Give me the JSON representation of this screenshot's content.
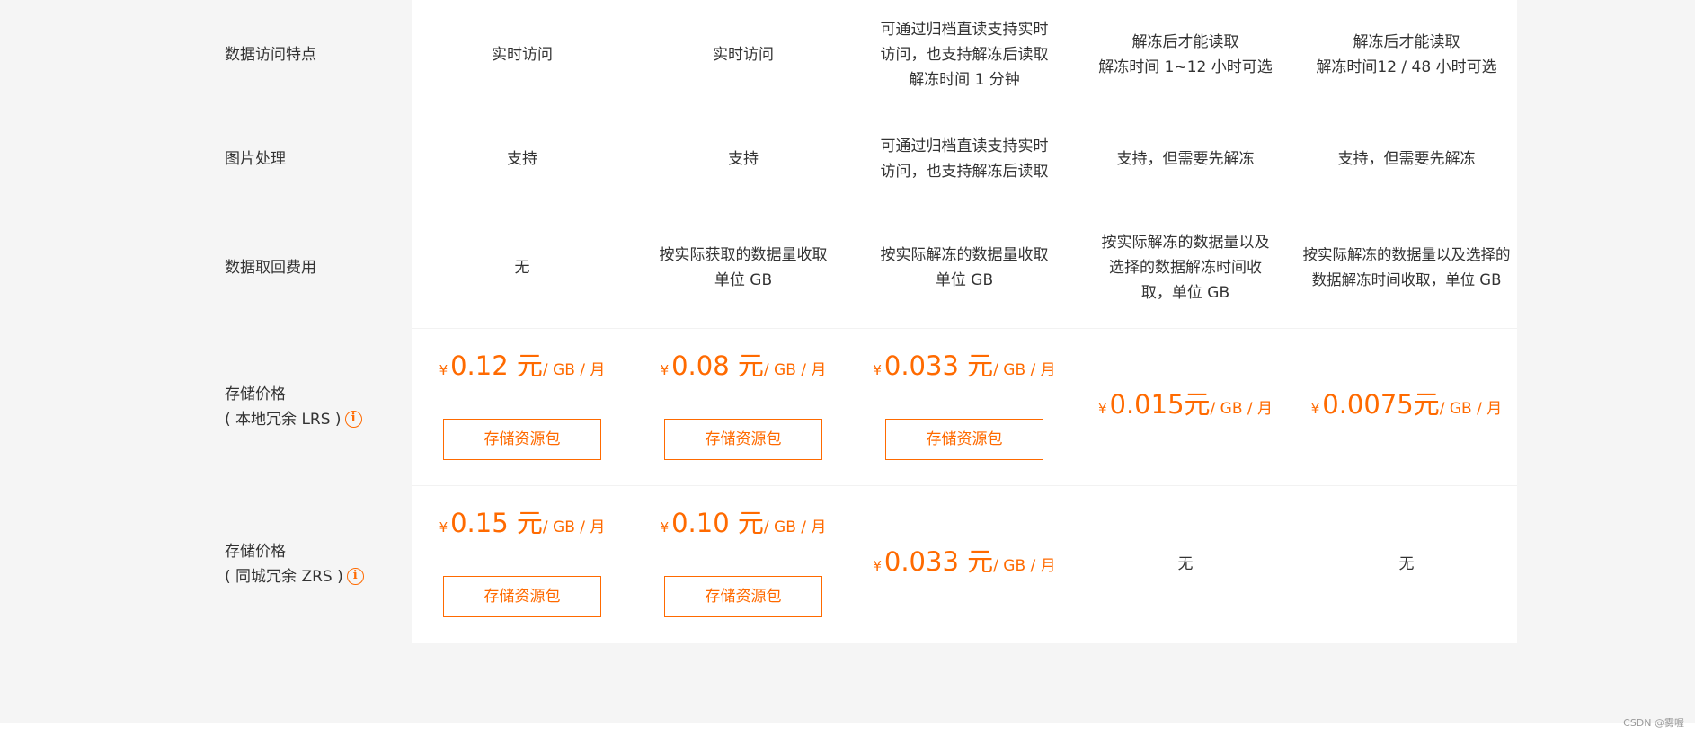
{
  "table": {
    "rows": [
      {
        "label": "数据访问特点",
        "cells": [
          "实时访问",
          "实时访问",
          "可通过归档直读支持实时\n访问，也支持解冻后读取\n解冻时间 1 分钟",
          "解冻后才能读取\n解冻时间 1~12 小时可选",
          "解冻后才能读取\n解冻时间12 / 48 小时可选"
        ]
      },
      {
        "label": "图片处理",
        "cells": [
          "支持",
          "支持",
          "可通过归档直读支持实时\n访问，也支持解冻后读取",
          "支持，但需要先解冻",
          "支持，但需要先解冻"
        ]
      },
      {
        "label": "数据取回费用",
        "cells": [
          "无",
          "按实际获取的数据量收取\n单位 GB",
          "按实际解冻的数据量收取\n单位 GB",
          "按实际解冻的数据量以及\n选择的数据解冻时间收\n取，单位 GB",
          "按实际解冻的数据量以及选择的\n数据解冻时间收取，单位 GB"
        ]
      },
      {
        "label_line1": "存储价格",
        "label_line2": "( 本地冗余 LRS )",
        "prices": [
          {
            "yen": "¥",
            "amount": "0.12 元",
            "unit": "/ GB / 月",
            "button": "存储资源包"
          },
          {
            "yen": "¥",
            "amount": "0.08 元",
            "unit": "/ GB / 月",
            "button": "存储资源包"
          },
          {
            "yen": "¥",
            "amount": "0.033 元",
            "unit": "/ GB / 月",
            "button": "存储资源包"
          },
          {
            "yen": "¥",
            "amount": "0.015元",
            "unit": "/ GB / 月"
          },
          {
            "yen": "¥",
            "amount": "0.0075元",
            "unit": "/ GB / 月"
          }
        ]
      },
      {
        "label_line1": "存储价格",
        "label_line2": "( 同城冗余 ZRS )",
        "prices": [
          {
            "yen": "¥",
            "amount": "0.15 元",
            "unit": "/ GB / 月",
            "button": "存储资源包"
          },
          {
            "yen": "¥",
            "amount": "0.10 元",
            "unit": "/ GB / 月",
            "button": "存储资源包"
          },
          {
            "yen": "¥",
            "amount": "0.033 元",
            "unit": "/ GB / 月"
          }
        ],
        "text_cells": [
          "无",
          "无"
        ]
      }
    ]
  },
  "icons": {
    "info": "info-icon",
    "info_glyph": "i"
  },
  "colors": {
    "accent": "#ff6a00",
    "label_bg": "#f5f5f5",
    "text": "#333333"
  },
  "watermark": "CSDN @雾喔"
}
